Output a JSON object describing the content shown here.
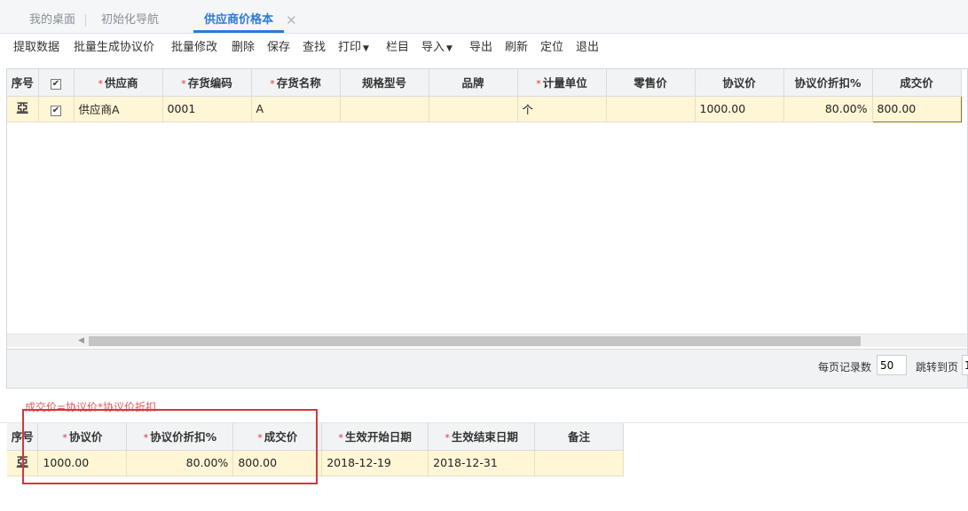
{
  "tabs": [
    {
      "label": "我的桌面"
    },
    {
      "label": "初始化导航"
    },
    {
      "label": "供应商价格本",
      "active": true
    }
  ],
  "toolbar": {
    "fetch": "提取数据",
    "batch_gen": "批量生成协议价",
    "batch_edit": "批量修改",
    "delete": "删除",
    "save": "保存",
    "find": "查找",
    "print": "打印",
    "columns": "栏目",
    "import": "导入",
    "export": "导出",
    "refresh": "刷新",
    "locate": "定位",
    "exit": "退出"
  },
  "grid": {
    "headers": {
      "seq": "序号",
      "supplier": "供应商",
      "code": "存货编码",
      "name": "存货名称",
      "spec": "规格型号",
      "brand": "品牌",
      "unit": "计量单位",
      "retail": "零售价",
      "agreed": "协议价",
      "discount": "协议价折扣%",
      "deal": "成交价"
    },
    "row": {
      "checked": true,
      "supplier": "供应商A",
      "code": "0001",
      "name": "A",
      "spec": "",
      "brand": "",
      "unit": "个",
      "retail": "",
      "agreed": "1000.00",
      "discount": "80.00%",
      "deal": "800.00"
    }
  },
  "pager": {
    "per_page_label": "每页记录数",
    "per_page_value": "50",
    "jump_label": "跳转到页",
    "jump_value": "1"
  },
  "formula_note": "成交价=协议价*协议价折扣",
  "sub_grid": {
    "headers": {
      "seq": "序号",
      "agreed": "协议价",
      "discount": "协议价折扣%",
      "deal": "成交价",
      "start": "生效开始日期",
      "end": "生效结束日期",
      "remark": "备注"
    },
    "row": {
      "agreed": "1000.00",
      "discount": "80.00%",
      "deal": "800.00",
      "start": "2018-12-19",
      "end": "2018-12-31",
      "remark": ""
    }
  },
  "colors": {
    "accent": "#2b7bd6",
    "required": "#e03535",
    "row_bg": "#fff6d6",
    "highlight_box": "#d7353b"
  }
}
